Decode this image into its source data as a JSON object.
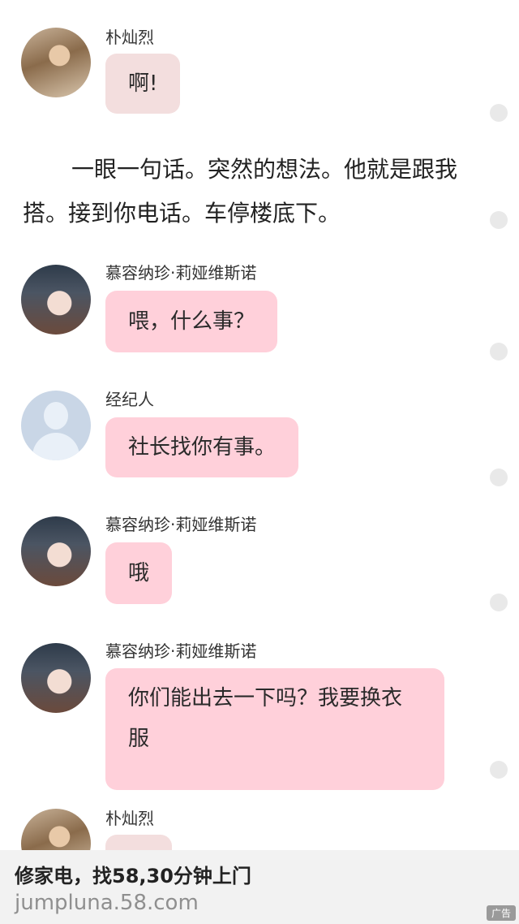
{
  "messages": [
    {
      "name": "朴灿烈",
      "text": "啊!"
    },
    {
      "name": "慕容纳珍·莉娅维斯诺",
      "text": "喂，什么事？"
    },
    {
      "name": "经纪人",
      "text": "社长找你有事。"
    },
    {
      "name": "慕容纳珍·莉娅维斯诺",
      "text": "哦"
    },
    {
      "name": "慕容纳珍·莉娅维斯诺",
      "text": "你们能出去一下吗？我要换衣服"
    },
    {
      "name": "朴灿烈",
      "text": ""
    }
  ],
  "narration": "一眼一句话。突然的想法。他就是跟我搭。接到你电话。车停楼底下。",
  "ad": {
    "title": "修家电，找58,30分钟上门",
    "url": "jumpluna.58.com",
    "badge": "广告"
  }
}
